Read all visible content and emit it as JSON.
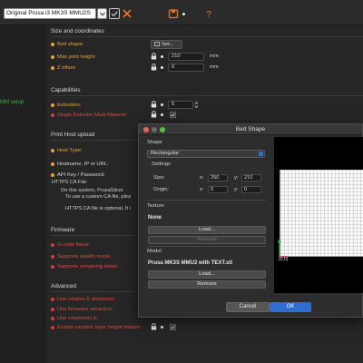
{
  "toolbar": {
    "printer_preset": "Original Prusa i3 MK3S MMU2S",
    "icons": [
      "chevron-down-icon",
      "check-icon",
      "close-icon",
      "save-icon",
      "help-icon"
    ]
  },
  "sidebar": {
    "items": [
      {
        "label": "MM setup"
      }
    ]
  },
  "main": {
    "size_section": {
      "title": "Size and coordinates",
      "bed_shape_label": "Bed shape:",
      "bed_shape_button": "Set...",
      "max_print_height_label": "Max print height:",
      "max_print_height_value": "210",
      "max_print_height_unit": "mm",
      "z_offset_label": "Z offset:",
      "z_offset_value": "0",
      "z_offset_unit": "mm"
    },
    "capabilities_section": {
      "title": "Capabilities",
      "extruders_label": "Extruders:",
      "extruders_value": "5",
      "single_extruder_label": "Single Extruder Multi Material:"
    },
    "host_section": {
      "title": "Print Host upload",
      "host_type_label": "Host Type:",
      "hostname_label": "Hostname, IP or URL:",
      "api_key_label": "API Key / Password:",
      "ca_file_label": "HTTPS CA File:",
      "ca_text_1": "On this system, PrusaSlicer",
      "ca_text_2": "To use a custom CA file, plea",
      "ca_text_3": "HTTPS CA file is optional. It i"
    },
    "firmware_section": {
      "title": "Firmware",
      "gcode_flavor_label": "G-code flavor:",
      "stealth_label": "Supports stealth mode:",
      "remaining_times_label": "Supports remaining times:"
    },
    "advanced_section": {
      "title": "Advanced",
      "relative_e_label": "Use relative E distances:",
      "fw_retraction_label": "Use firmware retraction:",
      "volumetric_label": "Use volumetric E:",
      "variable_layer_label": "Enable variable layer height feature:"
    }
  },
  "dialog": {
    "title": "Bed Shape",
    "shape_group": "Shape",
    "shape_value": "Rectangular",
    "settings_group": "Settings",
    "size_label": "Size:",
    "size_x_axis": "x:",
    "size_x": "250",
    "size_y_axis": "y:",
    "size_y": "210",
    "origin_label": "Origin:",
    "origin_x_axis": "x:",
    "origin_x": "0",
    "origin_y_axis": "y:",
    "origin_y": "0",
    "texture_group": "Texture",
    "texture_value": "None",
    "texture_load": "Load...",
    "texture_remove": "Remove",
    "model_group": "Model",
    "model_value": "Prusa MK3S MMU2 with TEXT.stl",
    "model_load": "Load...",
    "model_remove": "Remove",
    "cancel": "Cancel",
    "ok": "OK",
    "origin_coord": "(0,0)"
  },
  "colors": {
    "accent_blue": "#2f6ecf",
    "green": "#3cb043",
    "orange": "#e8a33c",
    "red": "#e2473d"
  }
}
